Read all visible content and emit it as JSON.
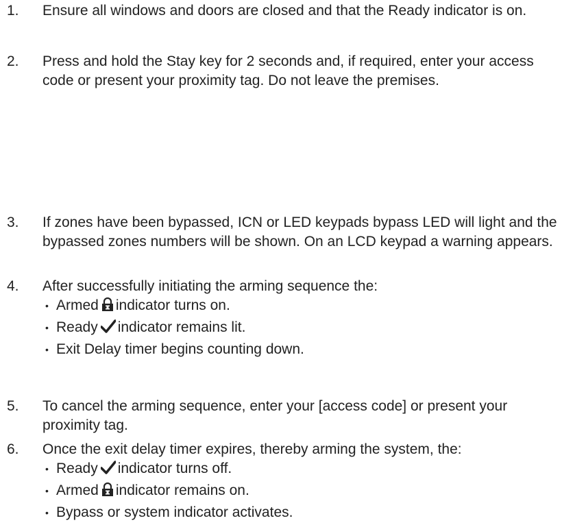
{
  "steps": [
    {
      "number": "1.",
      "text": "Ensure all windows and doors are closed and that the Ready indicator is on."
    },
    {
      "number": "2.",
      "text": "Press and hold the Stay key for 2 seconds and, if required, enter your access code or present your proximity tag. Do not leave the premises."
    },
    {
      "number": "3.",
      "text": "If zones have been bypassed, ICN or LED keypads bypass LED will light and the bypassed zones numbers will be shown. On an LCD keypad a warning appears."
    },
    {
      "number": "4.",
      "text": "After successfully initiating the arming sequence the:",
      "bullets": [
        {
          "before": "Armed",
          "icon": "lock-icon",
          "after": "indicator turns on."
        },
        {
          "before": "Ready",
          "icon": "checkmark-icon",
          "after": "indicator remains lit."
        },
        {
          "before": "",
          "icon": "",
          "after": "Exit Delay timer begins counting down."
        }
      ]
    },
    {
      "number": "5.",
      "text": "To cancel the arming sequence, enter your [access code] or present your proximity tag."
    },
    {
      "number": "6.",
      "text": "Once the exit delay timer expires, thereby arming the system, the:",
      "bullets": [
        {
          "before": "Ready",
          "icon": "checkmark-icon",
          "after": "indicator turns off."
        },
        {
          "before": "Armed",
          "icon": "lock-icon",
          "after": "indicator remains on."
        },
        {
          "before": "",
          "icon": "",
          "after": "Bypass or system indicator activates."
        }
      ]
    }
  ],
  "bullet_glyph": "•",
  "colors": {
    "text": "#222222",
    "background": "#ffffff"
  }
}
